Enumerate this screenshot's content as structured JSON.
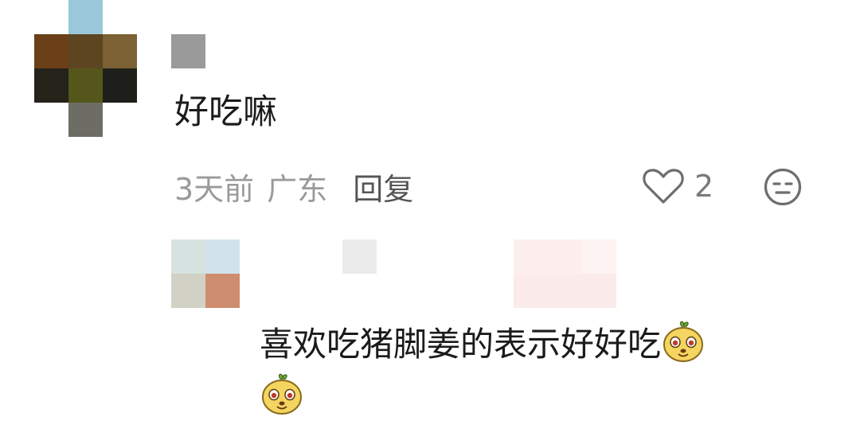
{
  "comment": {
    "avatar_icon": "pixelated-avatar",
    "username_icon": "pixelated-username",
    "text": "好吃嘛",
    "time": "3天前",
    "location": "广东",
    "reply_label": "回复",
    "like_icon": "heart-outline-icon",
    "like_count": "2",
    "dislike_icon": "meh-face-icon"
  },
  "reply": {
    "avatar_icon": "pixelated-avatar",
    "username_icon": "pixelated-username",
    "text": "喜欢吃猪脚姜的表示好好吃",
    "emoji_icon": "yellow-mango-emoji"
  },
  "colors": {
    "text_primary": "#1b1b1b",
    "text_secondary": "#9a9a9a",
    "reply_action": "#555555",
    "emoji_yellow": "#f3d560"
  }
}
